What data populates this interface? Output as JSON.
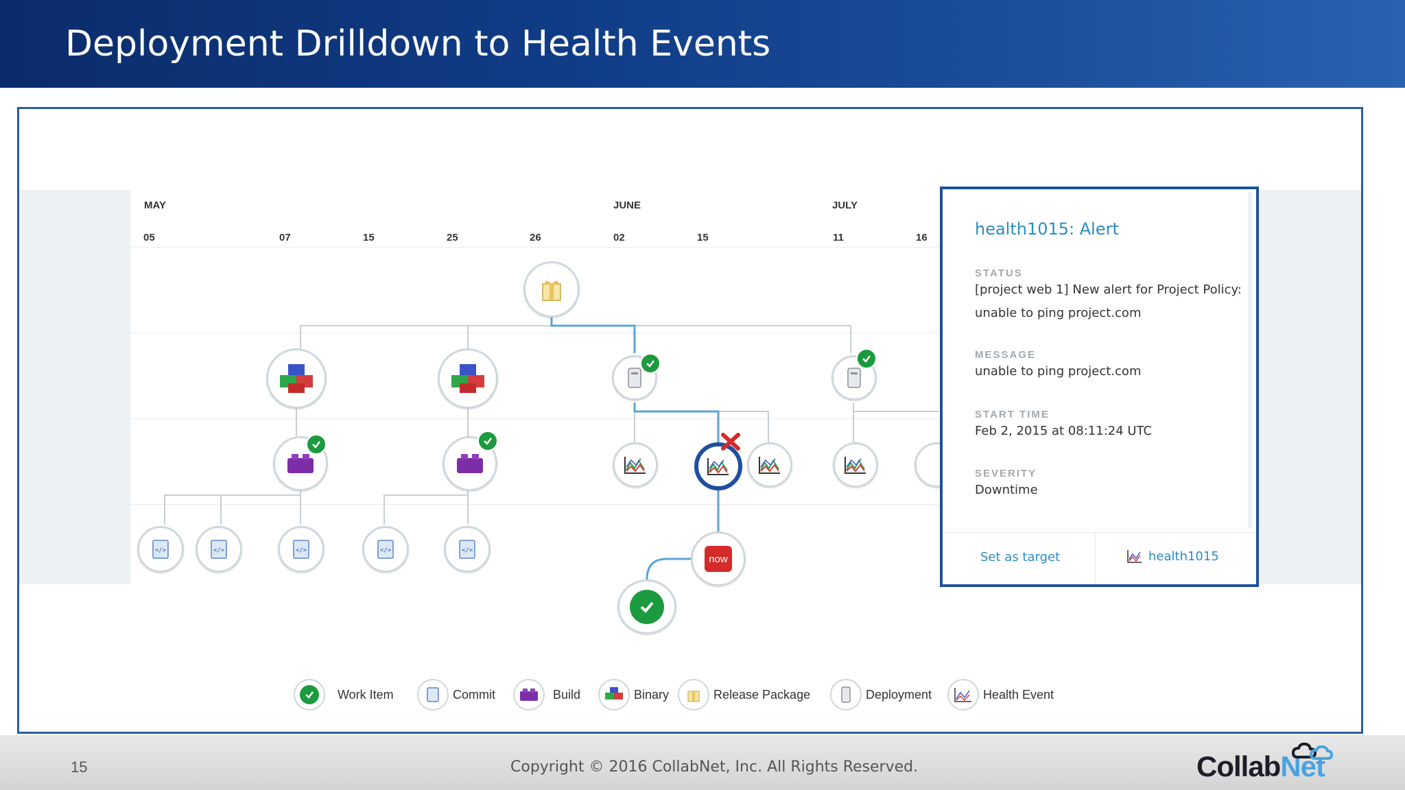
{
  "slide": {
    "title": "Deployment Drilldown to Health Events",
    "page_number": "15",
    "copyright": "Copyright © 2016 CollabNet, Inc.  All Rights Reserved.",
    "logo_part1": "Collab",
    "logo_part2": "Net"
  },
  "timeline": {
    "months": [
      "MAY",
      "JUNE",
      "JULY"
    ],
    "days": [
      "05",
      "07",
      "15",
      "25",
      "26",
      "02",
      "15",
      "11",
      "16"
    ]
  },
  "nodes": {
    "now_label": "now"
  },
  "detail_panel": {
    "title": "health1015: Alert",
    "status_label": "STATUS",
    "status_value": "[project web 1] New alert for Project Policy: unable to ping project.com",
    "message_label": "MESSAGE",
    "message_value": "unable to ping project.com",
    "start_time_label": "START TIME",
    "start_time_value": "Feb 2, 2015 at 08:11:24 UTC",
    "severity_label": "SEVERITY",
    "severity_value": "Downtime",
    "set_target_label": "Set as target",
    "health_link_label": "health1015"
  },
  "legend": {
    "work_item": "Work Item",
    "commit": "Commit",
    "build": "Build",
    "binary": "Binary",
    "release_package": "Release Package",
    "deployment": "Deployment",
    "health_event": "Health Event"
  },
  "colors": {
    "header_blue": "#103c86",
    "accent_blue": "#2b8cbf",
    "selection_ring": "#1f4f9e",
    "success_green": "#1c9a3e",
    "alert_red": "#d42a2a"
  }
}
